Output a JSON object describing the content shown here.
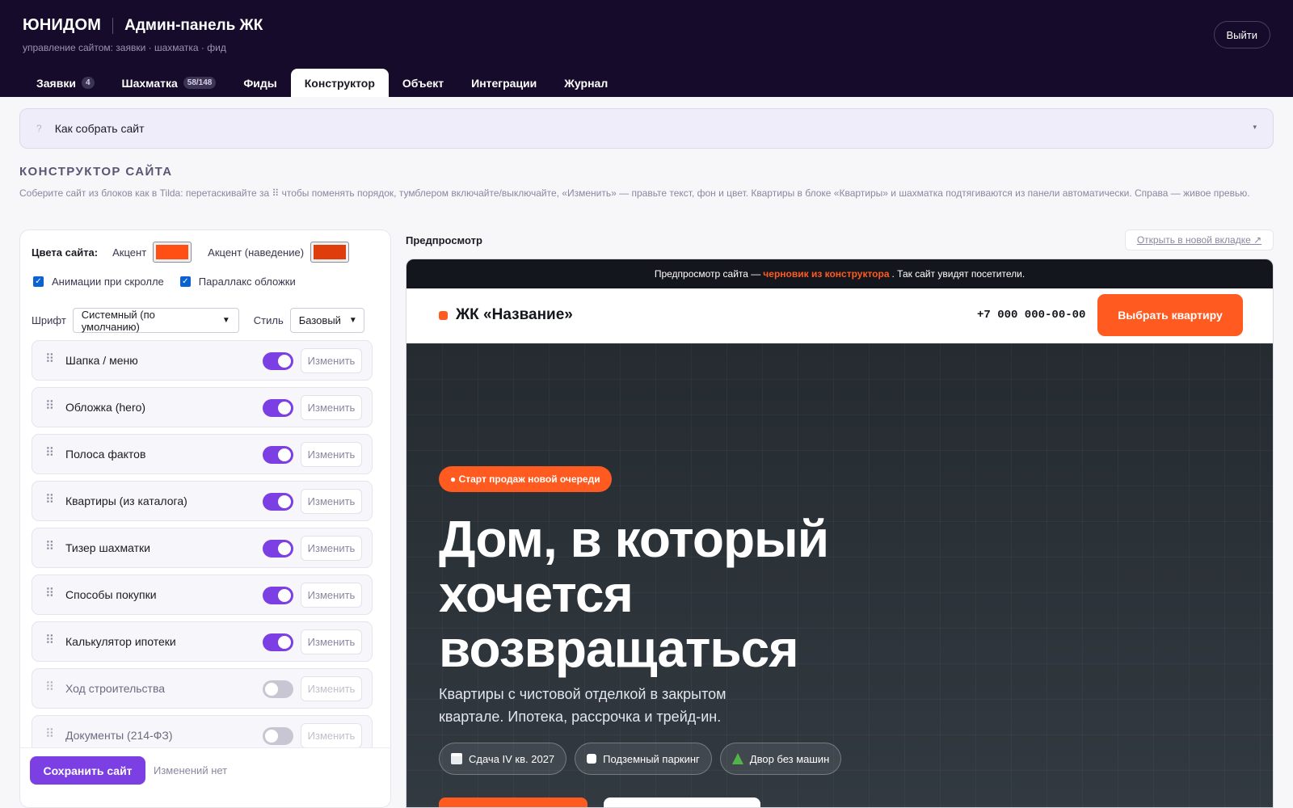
{
  "header": {
    "logo": "ЮНИДОМ",
    "title": "Админ-панель ЖК",
    "subtitle": "управление сайтом: заявки · шахматка · фид",
    "logout_label": "Выйти"
  },
  "tabs": [
    {
      "label": "Заявки",
      "badge": "4"
    },
    {
      "label": "Шахматка",
      "badge": "58/148"
    },
    {
      "label": "Фиды",
      "badge": ""
    },
    {
      "label": "Конструктор",
      "badge": ""
    },
    {
      "label": "Объект",
      "badge": ""
    },
    {
      "label": "Интеграции",
      "badge": ""
    },
    {
      "label": "Журнал",
      "badge": ""
    }
  ],
  "active_tab": "Конструктор",
  "help": {
    "icon": "?",
    "title": "Как собрать сайт",
    "chevron": "▾"
  },
  "section": {
    "title": "КОНСТРУКТОР САЙТА",
    "description": "Соберите сайт из блоков как в Tilda: перетаскивайте за ⠿ чтобы поменять порядок, тумблером включайте/выключайте, «Изменить» — правьте текст, фон и цвет. Квартиры в блоке «Квартиры» и шахматка подтягиваются из панели автоматически. Справа — живое превью."
  },
  "settings": {
    "colors_label": "Цвета сайта:",
    "accent_label": "Акцент",
    "accent_color": "#ff4f14",
    "accent_hover_label": "Акцент (наведение)",
    "accent_hover_color": "#e03d0c",
    "scroll_anim_label": "Анимации при скролле",
    "scroll_anim_checked": true,
    "parallax_label": "Параллакс обложки",
    "parallax_checked": true,
    "font_label": "Шрифт",
    "font_value": "Системный (по умолчанию)",
    "style_label": "Стиль",
    "style_value": "Базовый"
  },
  "blocks": [
    {
      "label": "Шапка / меню",
      "enabled": true
    },
    {
      "label": "Обложка (hero)",
      "enabled": true
    },
    {
      "label": "Полоса фактов",
      "enabled": true
    },
    {
      "label": "Квартиры (из каталога)",
      "enabled": true
    },
    {
      "label": "Тизер шахматки",
      "enabled": true
    },
    {
      "label": "Способы покупки",
      "enabled": true
    },
    {
      "label": "Калькулятор ипотеки",
      "enabled": true
    },
    {
      "label": "Ход строительства",
      "enabled": false
    },
    {
      "label": "Документы (214-ФЗ)",
      "enabled": false
    }
  ],
  "block_edit_label": "Изменить",
  "drag_glyph": "⠿",
  "save": {
    "button_label": "Сохранить сайт",
    "status": "Изменений нет"
  },
  "preview": {
    "label": "Предпросмотр",
    "open_tab_label": "Открыть в новой вкладке ↗",
    "banner_before": "Предпросмотр сайта —",
    "banner_highlight": "черновик из конструктора",
    "banner_after": ". Так сайт увидят посетители.",
    "site_name": "ЖК «Название»",
    "phone": "+7 000 000-00-00",
    "cta_label": "Выбрать квартиру",
    "hero_pill": "● Старт продаж новой очереди",
    "hero_title": "Дом, в который хочется возвращаться",
    "hero_subtitle": "Квартиры с чистовой отделкой в закрытом квартале. Ипотека, рассрочка и трейд-ин.",
    "chips": [
      {
        "icon": "calendar-icon",
        "label": "Сдача IV кв. 2027"
      },
      {
        "icon": "parking-icon",
        "label": "Подземный паркинг"
      },
      {
        "icon": "tree-icon",
        "label": "Двор без машин"
      }
    ]
  }
}
